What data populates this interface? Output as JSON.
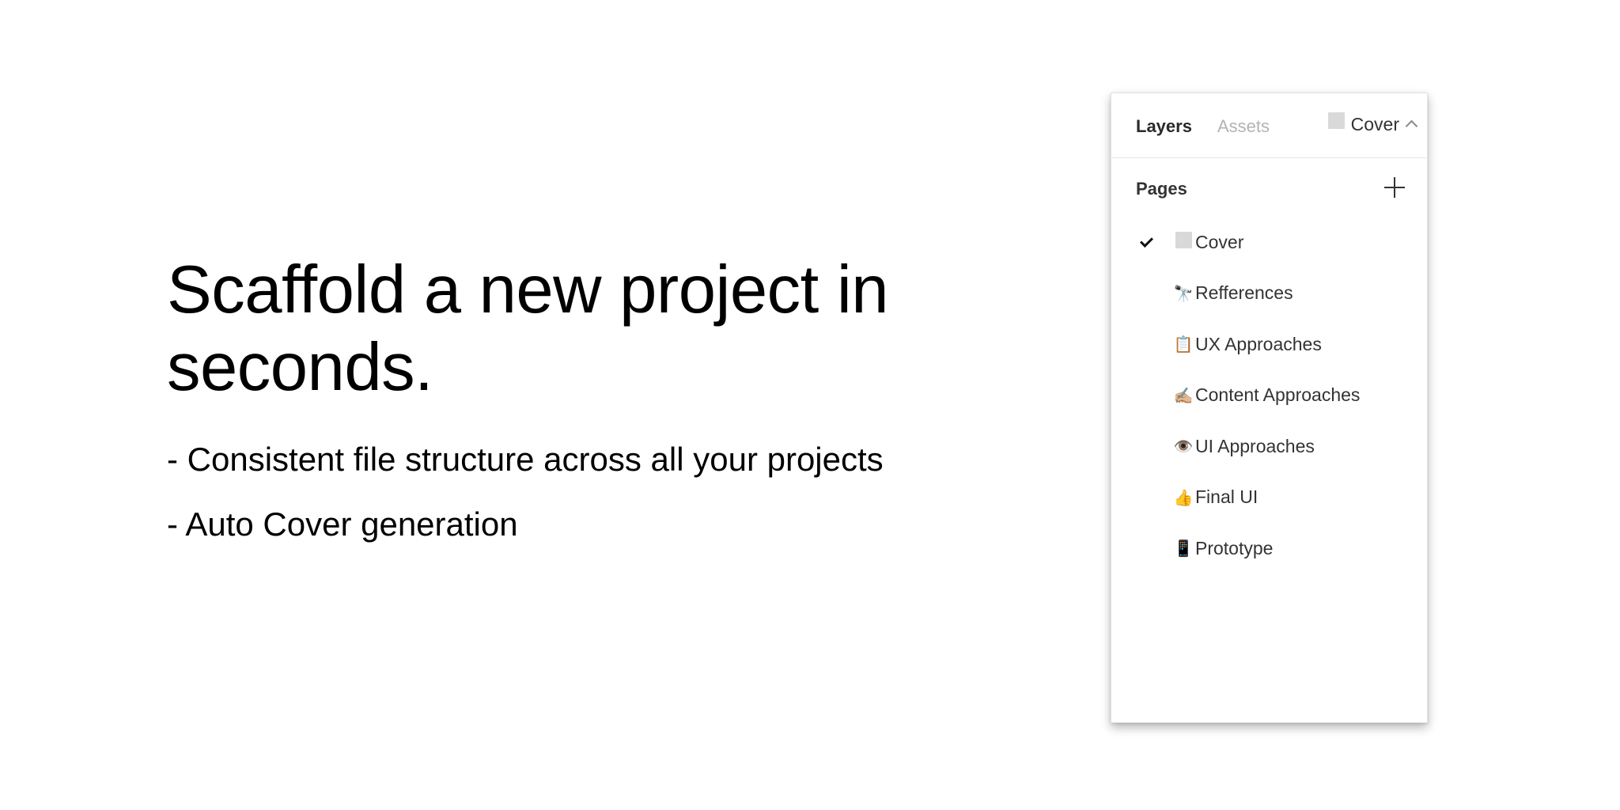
{
  "hero": {
    "title": "Scaffold a new project in seconds.",
    "bullets": [
      "- Consistent file structure across all your projects",
      "- Auto Cover generation"
    ]
  },
  "panel": {
    "tabs": {
      "layers": "Layers",
      "assets": "Assets"
    },
    "current_page": "Cover",
    "pages_title": "Pages",
    "pages": [
      {
        "icon": "",
        "label": "Cover",
        "selected": true
      },
      {
        "icon": "🔭",
        "label": "Refferences"
      },
      {
        "icon": "📋",
        "label": "UX Approaches"
      },
      {
        "icon": "✍🏼",
        "label": "Content Approaches"
      },
      {
        "icon": "👁️",
        "label": "UI Approaches"
      },
      {
        "icon": "👍",
        "label": "Final UI"
      },
      {
        "icon": "📱",
        "label": "Prototype"
      }
    ]
  }
}
